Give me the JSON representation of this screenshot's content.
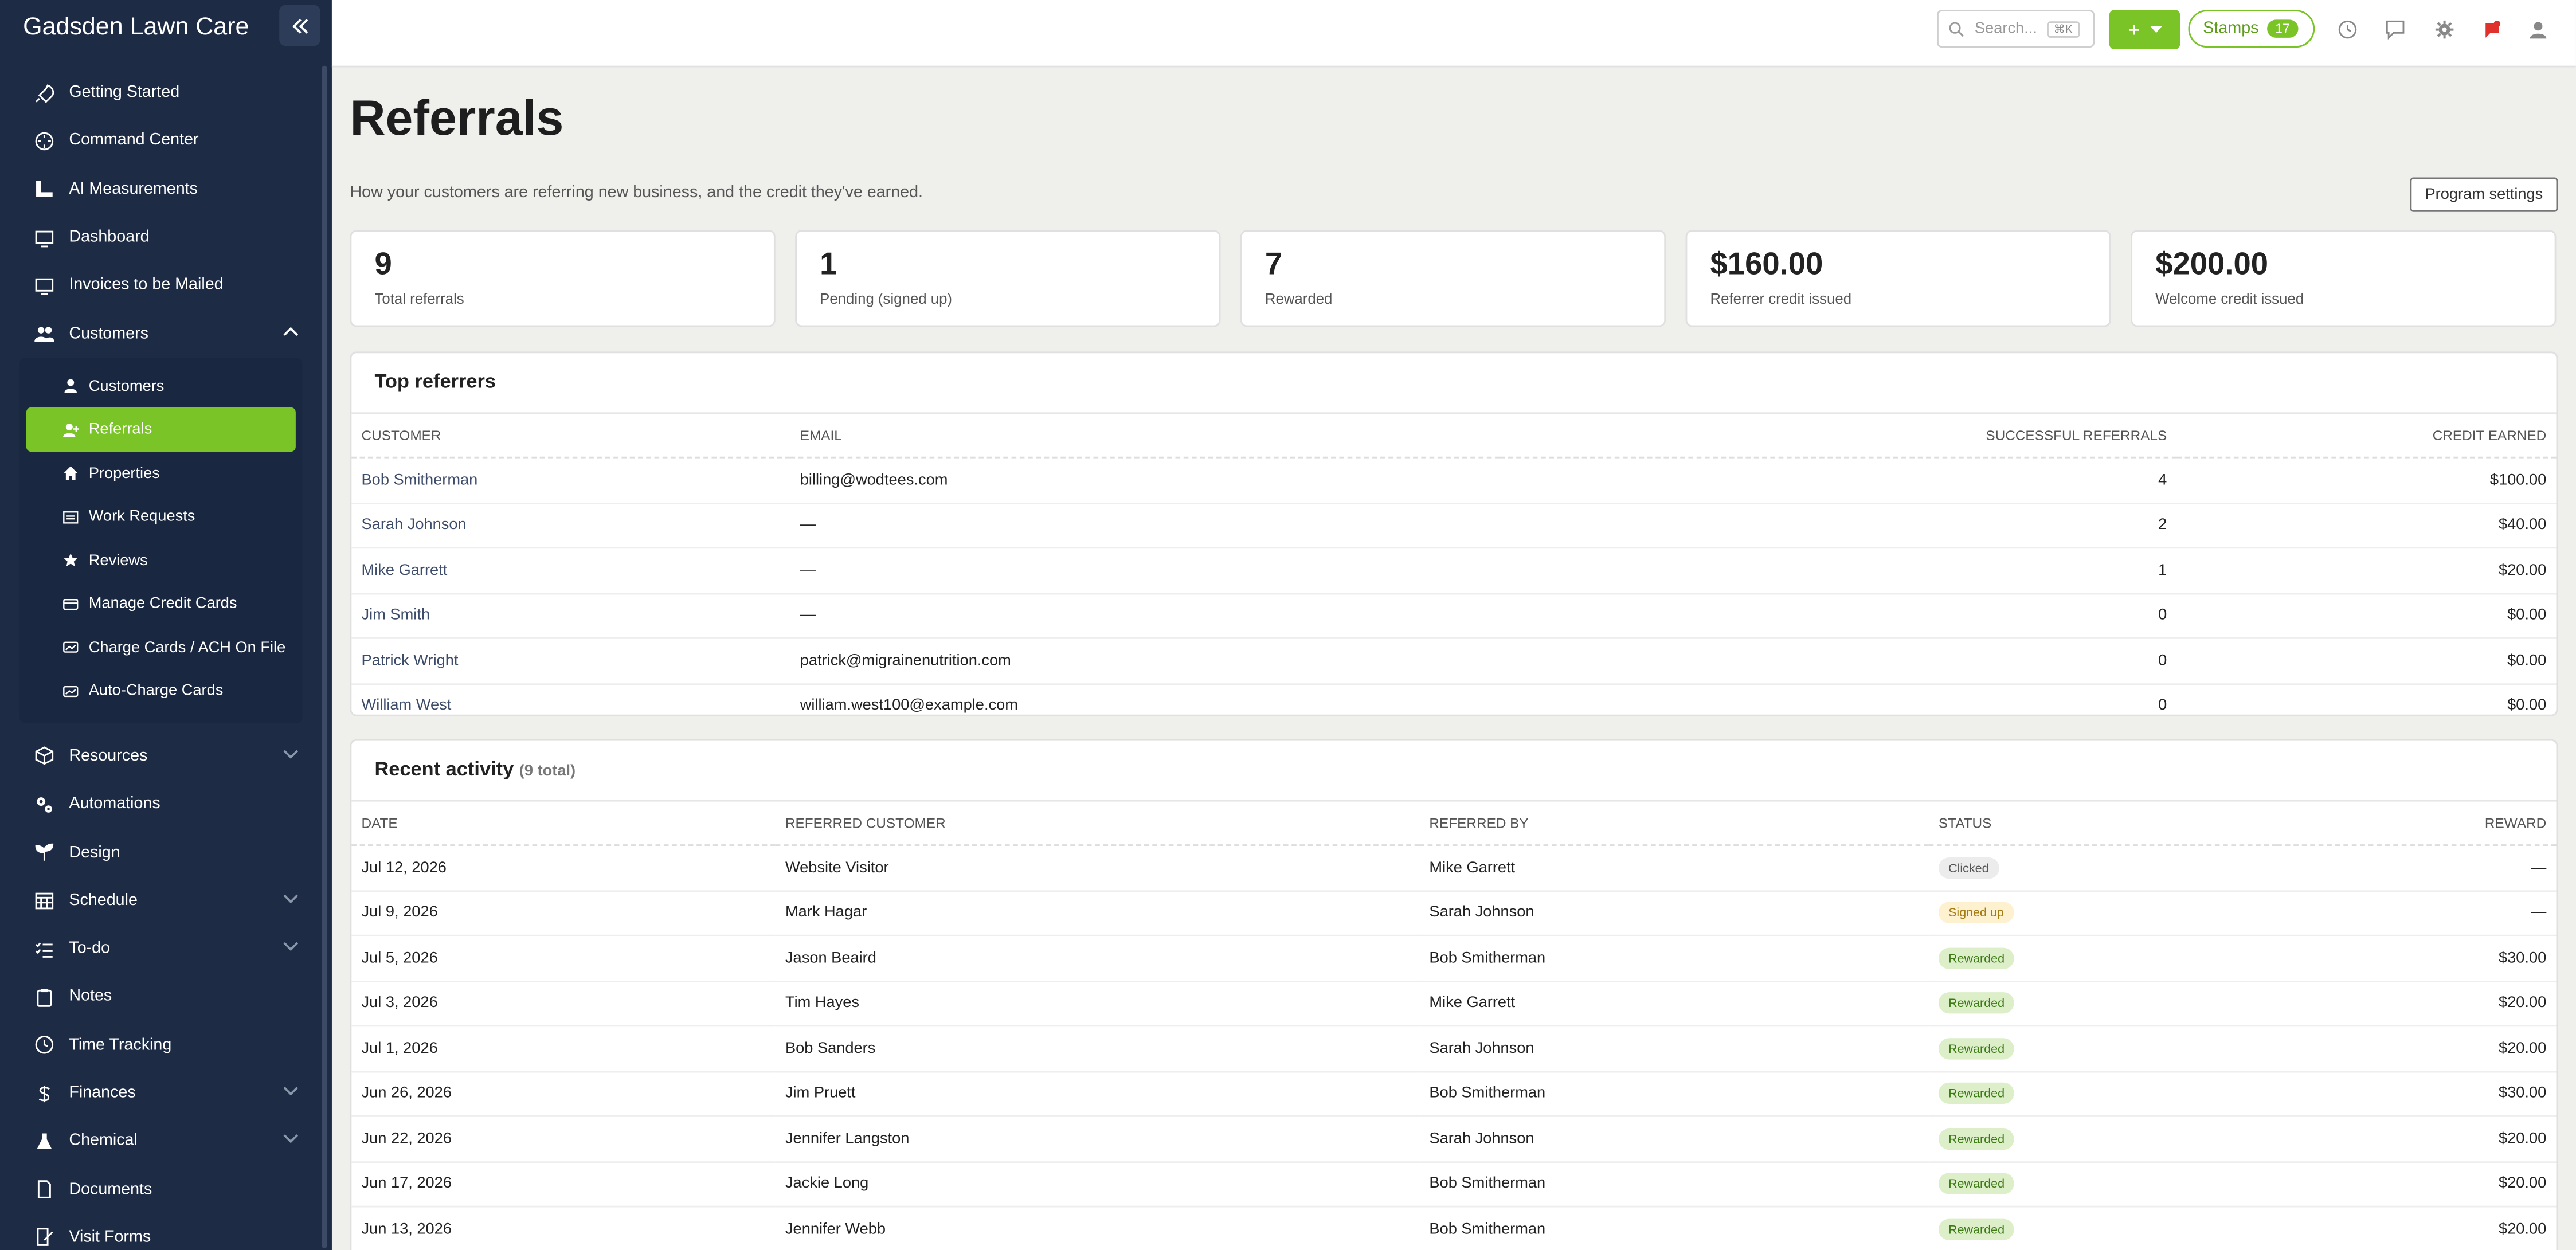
{
  "app": {
    "title": "Gadsden Lawn Care"
  },
  "sidebar": {
    "items_top": [
      {
        "label": "Getting Started",
        "icon": "rocket-icon"
      },
      {
        "label": "Command Center",
        "icon": "crosshair-icon"
      },
      {
        "label": "AI Measurements",
        "icon": "ruler-icon"
      },
      {
        "label": "Dashboard",
        "icon": "monitor-icon"
      },
      {
        "label": "Invoices to be Mailed",
        "icon": "monitor-icon"
      },
      {
        "label": "Customers",
        "icon": "users-icon"
      }
    ],
    "customers_sub": [
      {
        "label": "Customers",
        "icon": "user-icon"
      },
      {
        "label": "Referrals",
        "icon": "user-plus-icon"
      },
      {
        "label": "Properties",
        "icon": "home-icon"
      },
      {
        "label": "Work Requests",
        "icon": "list-icon"
      },
      {
        "label": "Reviews",
        "icon": "star-icon"
      },
      {
        "label": "Manage Credit Cards",
        "icon": "credit-card-icon"
      },
      {
        "label": "Charge Cards / ACH On File",
        "icon": "card-icon"
      },
      {
        "label": "Auto-Charge Cards",
        "icon": "card-icon"
      }
    ],
    "items_bottom": [
      {
        "label": "Resources",
        "icon": "cube-icon",
        "chevron": true
      },
      {
        "label": "Automations",
        "icon": "cogs-icon",
        "chevron": false
      },
      {
        "label": "Design",
        "icon": "seedling-icon",
        "chevron": false
      },
      {
        "label": "Schedule",
        "icon": "calendar-icon",
        "chevron": true
      },
      {
        "label": "To-do",
        "icon": "checklist-icon",
        "chevron": true
      },
      {
        "label": "Notes",
        "icon": "clipboard-icon",
        "chevron": false
      },
      {
        "label": "Time Tracking",
        "icon": "clock-icon",
        "chevron": false
      },
      {
        "label": "Finances",
        "icon": "dollar-icon",
        "chevron": true
      },
      {
        "label": "Chemical",
        "icon": "flask-icon",
        "chevron": true
      },
      {
        "label": "Documents",
        "icon": "document-icon",
        "chevron": false
      },
      {
        "label": "Visit Forms",
        "icon": "form-icon",
        "chevron": false
      }
    ]
  },
  "topbar": {
    "search_placeholder": "Search...",
    "search_shortcut": "⌘K",
    "stamps_label": "Stamps",
    "stamps_count": "17",
    "accent": "#7ac428"
  },
  "page": {
    "title": "Referrals",
    "subtitle": "How your customers are referring new business, and the credit they've earned.",
    "settings_button": "Program settings"
  },
  "stats": [
    {
      "value": "9",
      "label": "Total referrals"
    },
    {
      "value": "1",
      "label": "Pending (signed up)"
    },
    {
      "value": "7",
      "label": "Rewarded"
    },
    {
      "value": "$160.00",
      "label": "Referrer credit issued"
    },
    {
      "value": "$200.00",
      "label": "Welcome credit issued"
    }
  ],
  "top_referrers": {
    "title": "Top referrers",
    "columns": [
      "CUSTOMER",
      "EMAIL",
      "SUCCESSFUL REFERRALS",
      "CREDIT EARNED"
    ],
    "rows": [
      [
        "Bob Smitherman",
        "billing@wodtees.com",
        "4",
        "$100.00"
      ],
      [
        "Sarah Johnson",
        "—",
        "2",
        "$40.00"
      ],
      [
        "Mike Garrett",
        "—",
        "1",
        "$20.00"
      ],
      [
        "Jim Smith",
        "—",
        "0",
        "$0.00"
      ],
      [
        "Patrick Wright",
        "patrick@migrainenutrition.com",
        "0",
        "$0.00"
      ],
      [
        "William West",
        "william.west100@example.com",
        "0",
        "$0.00"
      ]
    ]
  },
  "recent_activity": {
    "title": "Recent activity",
    "count_note": "(9 total)",
    "columns": [
      "DATE",
      "REFERRED CUSTOMER",
      "REFERRED BY",
      "STATUS",
      "REWARD"
    ],
    "rows": [
      [
        "Jul 12, 2026",
        "Website Visitor",
        "Mike Garrett",
        "Clicked",
        "—"
      ],
      [
        "Jul 9, 2026",
        "Mark Hagar",
        "Sarah Johnson",
        "Signed up",
        "—"
      ],
      [
        "Jul 5, 2026",
        "Jason Beaird",
        "Bob Smitherman",
        "Rewarded",
        "$30.00"
      ],
      [
        "Jul 3, 2026",
        "Tim Hayes",
        "Mike Garrett",
        "Rewarded",
        "$20.00"
      ],
      [
        "Jul 1, 2026",
        "Bob Sanders",
        "Sarah Johnson",
        "Rewarded",
        "$20.00"
      ],
      [
        "Jun 26, 2026",
        "Jim Pruett",
        "Bob Smitherman",
        "Rewarded",
        "$30.00"
      ],
      [
        "Jun 22, 2026",
        "Jennifer Langston",
        "Sarah Johnson",
        "Rewarded",
        "$20.00"
      ],
      [
        "Jun 17, 2026",
        "Jackie Long",
        "Bob Smitherman",
        "Rewarded",
        "$20.00"
      ],
      [
        "Jun 13, 2026",
        "Jennifer Webb",
        "Bob Smitherman",
        "Rewarded",
        "$20.00"
      ]
    ]
  }
}
